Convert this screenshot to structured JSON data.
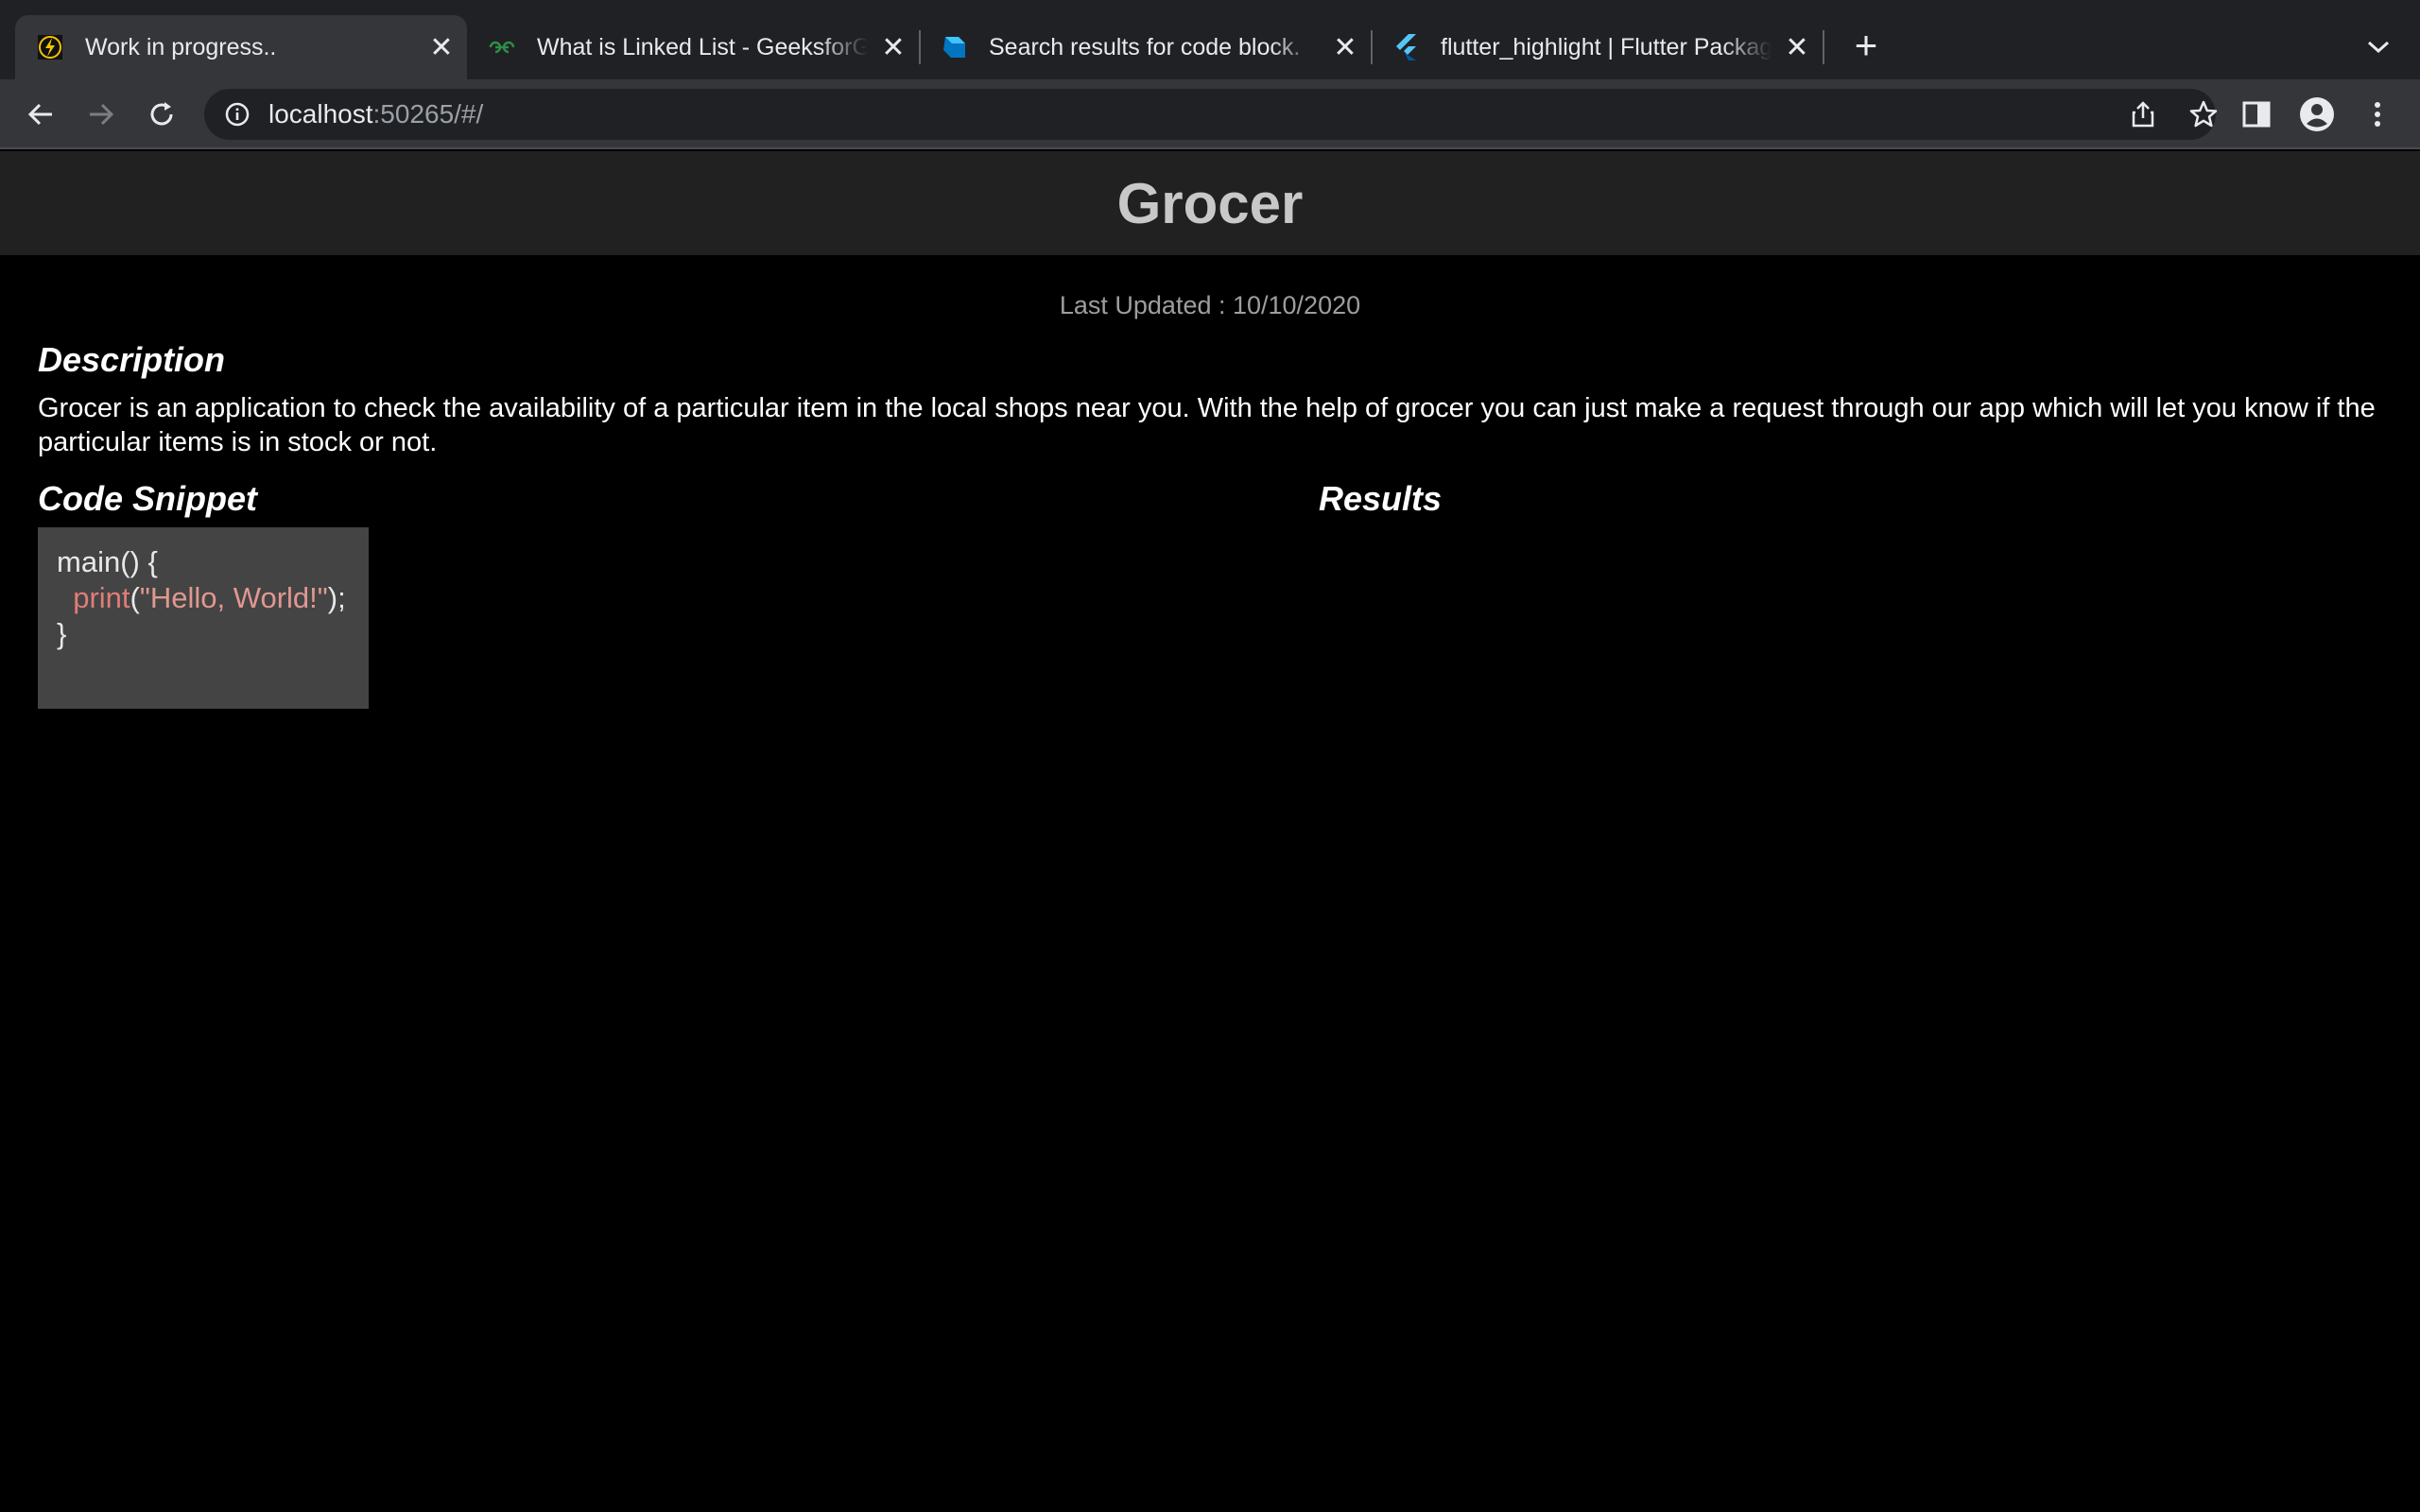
{
  "browser": {
    "tabs": [
      {
        "title": "Work in progress..",
        "icon": "bolt-favicon-icon",
        "active": true
      },
      {
        "title": "What is Linked List - GeeksforGeeks",
        "icon": "geeksforgeeks-favicon-icon",
        "active": false
      },
      {
        "title": "Search results for code block.",
        "icon": "dart-favicon-icon",
        "active": false
      },
      {
        "title": "flutter_highlight | Flutter Package",
        "icon": "flutter-favicon-icon",
        "active": false
      }
    ],
    "url_host": "localhost",
    "url_rest": ":50265/#/"
  },
  "app": {
    "title": "Grocer",
    "last_updated": "Last Updated : 10/10/2020",
    "description_heading": "Description",
    "description_text": "Grocer is an application to check the availability of a particular item in the local shops near you. With the help of grocer you can just make a request through our app which will let you know if the particular items is in stock or not.",
    "code_heading": "Code Snippet",
    "results_heading": "Results",
    "code": {
      "line1": "main() {",
      "line2_indent": "  ",
      "line2_fn": "print",
      "line2_open": "(",
      "line2_string": "\"Hello, World!\"",
      "line2_close": ");",
      "line3": "}"
    }
  },
  "colors": {
    "app_bar_bg": "#212121",
    "page_bg": "#000000",
    "code_bg": "#444444",
    "code_fn": "#e07c78"
  }
}
